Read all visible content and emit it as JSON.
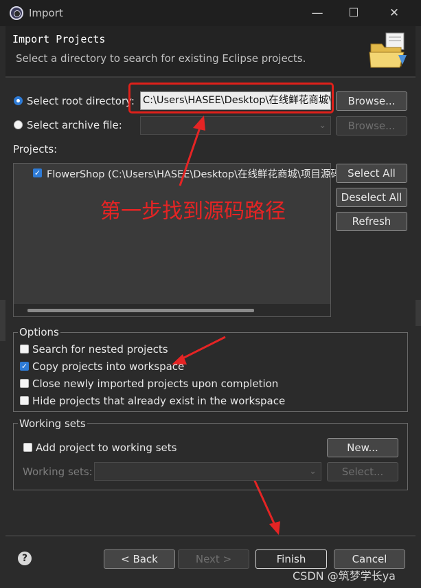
{
  "window": {
    "title": "Import",
    "header_title": "Import Projects",
    "header_description": "Select a directory to search for existing Eclipse projects."
  },
  "source": {
    "root_radio_label": "Select root directory:",
    "root_radio_selected": true,
    "root_path_value": "C:\\Users\\HASEE\\Desktop\\在线鲜花商城\\项目源码",
    "archive_radio_label": "Select archive file:",
    "archive_radio_selected": false,
    "archive_value": "",
    "browse_label": "Browse...",
    "browse_archive_label": "Browse..."
  },
  "projects": {
    "label": "Projects:",
    "items": [
      {
        "label": "FlowerShop (C:\\Users\\HASEE\\Desktop\\在线鲜花商城\\项目源码\\FlowerShop)",
        "checked": true
      }
    ],
    "select_all_label": "Select All",
    "deselect_all_label": "Deselect All",
    "refresh_label": "Refresh"
  },
  "annotations": {
    "step_one_text": "第一步找到源码路径",
    "highlight_color": "#e0201a"
  },
  "options": {
    "group_label": "Options",
    "items": [
      {
        "label": "Search for nested projects",
        "checked": false
      },
      {
        "label": "Copy projects into workspace",
        "checked": true
      },
      {
        "label": "Close newly imported projects upon completion",
        "checked": false
      },
      {
        "label": "Hide projects that already exist in the workspace",
        "checked": false
      }
    ]
  },
  "working_sets": {
    "group_label": "Working sets",
    "add_label": "Add project to working sets",
    "add_checked": false,
    "new_label": "New...",
    "working_sets_label": "Working sets:",
    "select_label": "Select..."
  },
  "footer": {
    "back_label": "< Back",
    "next_label": "Next >",
    "finish_label": "Finish",
    "cancel_label": "Cancel",
    "watermark": "CSDN @筑梦学长ya"
  },
  "icons": [
    "eclipse-app-icon",
    "minimize-icon",
    "maximize-icon",
    "close-icon",
    "import-folder-icon",
    "chevron-down-icon",
    "help-icon"
  ],
  "accent_color": "#2e7bd6"
}
